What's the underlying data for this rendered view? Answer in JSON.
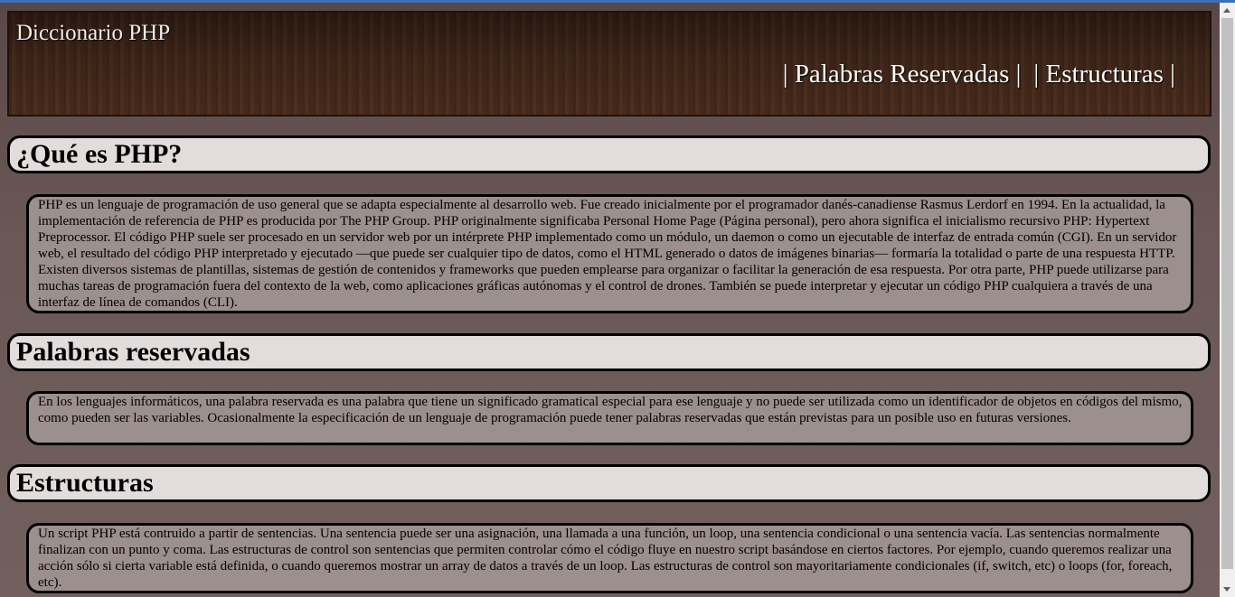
{
  "header": {
    "site_title": "Diccionario PHP",
    "nav": [
      "| Palabras Reservadas |",
      "| Estructuras |"
    ]
  },
  "sections": [
    {
      "title": "¿Qué es PHP?",
      "body": "PHP es un lenguaje de programación de uso general que se adapta especialmente al desarrollo web. Fue creado inicialmente por el programador danés-canadiense Rasmus Lerdorf en 1994. En la actualidad, la implementación de referencia de PHP es producida por The PHP Group. PHP originalmente significaba Personal Home Page (Página personal), pero ahora significa el inicialismo recursivo PHP: Hypertext Preprocessor. El código PHP suele ser procesado en un servidor web por un intérprete PHP implementado como un módulo, un daemon o como un ejecutable de interfaz de entrada común (CGI). En un servidor web, el resultado del código PHP interpretado y ejecutado —que puede ser cualquier tipo de datos, como el HTML generado o datos de imágenes binarias— formaría la totalidad o parte de una respuesta HTTP. Existen diversos sistemas de plantillas, sistemas de gestión de contenidos y frameworks que pueden emplearse para organizar o facilitar la generación de esa respuesta. Por otra parte, PHP puede utilizarse para muchas tareas de programación fuera del contexto de la web, como aplicaciones gráficas autónomas y el control de drones. También se puede interpretar y ejecutar un código PHP cualquiera a través de una interfaz de línea de comandos (CLI)."
    },
    {
      "title": "Palabras reservadas",
      "body": "En los lenguajes informáticos, una palabra reservada es una palabra que tiene un significado gramatical especial para ese lenguaje y no puede ser utilizada como un identificador de objetos en códigos del mismo, como pueden ser las variables. Ocasionalmente la especificación de un lenguaje de programación puede tener palabras reservadas que están previstas para un posible uso en futuras versiones."
    },
    {
      "title": "Estructuras",
      "body": "Un script PHP está contruido a partir de sentencias. Una sentencia puede ser una asignación, una llamada a una función, un loop, una sentencia condicional o una sentencia vacía. Las sentencias normalmente finalizan con un punto y coma. Las estructuras de control son sentencias que permiten controlar cómo el código fluye en nuestro script basándose en ciertos factores. Por ejemplo, cuando queremos realizar una acción sólo si cierta variable está definida, o cuando queremos mostrar un array de datos a través de un loop. Las estructuras de control son mayoritariamente condicionales (if, switch, etc) o loops (for, foreach, etc)."
    }
  ]
}
